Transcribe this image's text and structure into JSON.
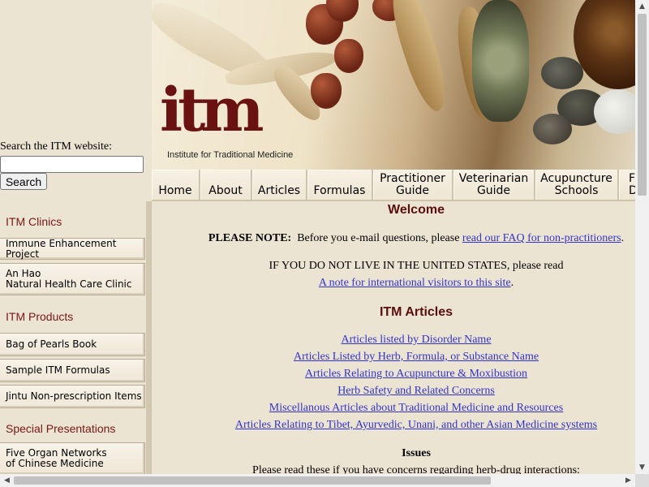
{
  "search": {
    "label": "Search the ITM website:",
    "input_value": "",
    "button_label": "Search"
  },
  "sidebar": {
    "sections": [
      {
        "title": "ITM Clinics",
        "items": [
          {
            "lines": [
              "Immune Enhancement Project"
            ]
          },
          {
            "lines": [
              "An Hao",
              "Natural Health Care Clinic"
            ]
          }
        ]
      },
      {
        "title": "ITM Products",
        "items": [
          {
            "lines": [
              "Bag of Pearls Book"
            ]
          },
          {
            "lines": [
              "Sample ITM Formulas"
            ]
          },
          {
            "lines": [
              "Jintu Non-prescription Items"
            ]
          }
        ]
      },
      {
        "title": "Special Presentations",
        "items": [
          {
            "lines": [
              "Five Organ Networks",
              "of Chinese Medicine"
            ]
          }
        ]
      }
    ]
  },
  "banner": {
    "logo_text": "itm",
    "logo_subtitle": "Institute for Traditional Medicine"
  },
  "topnav": {
    "tabs": [
      {
        "lines": [
          "Home"
        ]
      },
      {
        "lines": [
          "About"
        ]
      },
      {
        "lines": [
          "Articles"
        ]
      },
      {
        "lines": [
          "Formulas"
        ]
      },
      {
        "lines": [
          "Practitioner",
          "Guide"
        ]
      },
      {
        "lines": [
          "Veterinarian",
          "Guide"
        ]
      },
      {
        "lines": [
          "Acupuncture",
          "Schools"
        ]
      },
      {
        "lines": [
          "F",
          "D"
        ]
      }
    ]
  },
  "main": {
    "welcome": "Welcome",
    "note_bold": "PLEASE NOTE:",
    "note_text": "Before you e-mail questions, please",
    "note_link": "read our FAQ for non-practitioners",
    "note_end": ".",
    "intl_text": "IF YOU DO NOT LIVE IN THE UNITED STATES, please read",
    "intl_link": "A note for international visitors to this site",
    "intl_end": ".",
    "articles_title": "ITM Articles",
    "article_links": [
      "Articles listed by Disorder Name",
      "Articles Listed by Herb, Formula, or Substance Name",
      "Articles Relating to Acupuncture & Moxibustion",
      "Herb Safety and Related Concerns",
      "Miscellanous Articles about Traditional Medicine and Resources",
      "Articles Relating to Tibet, Ayurvedic, Unani, and other Asian Medicine systems"
    ],
    "issues_title": "Issues",
    "issues_text": "Please read these if you have concerns regarding herb-drug interactions:"
  },
  "scrollbars": {
    "up_icon": "triangle-up",
    "down_icon": "triangle-down",
    "left_icon": "triangle-left",
    "right_icon": "triangle-right"
  },
  "colors": {
    "page_bg": "#ece4d2",
    "heading": "#5a0e0e",
    "sidebar_heading": "#7a1616",
    "link": "#3333cc",
    "logo": "#6a1212"
  }
}
